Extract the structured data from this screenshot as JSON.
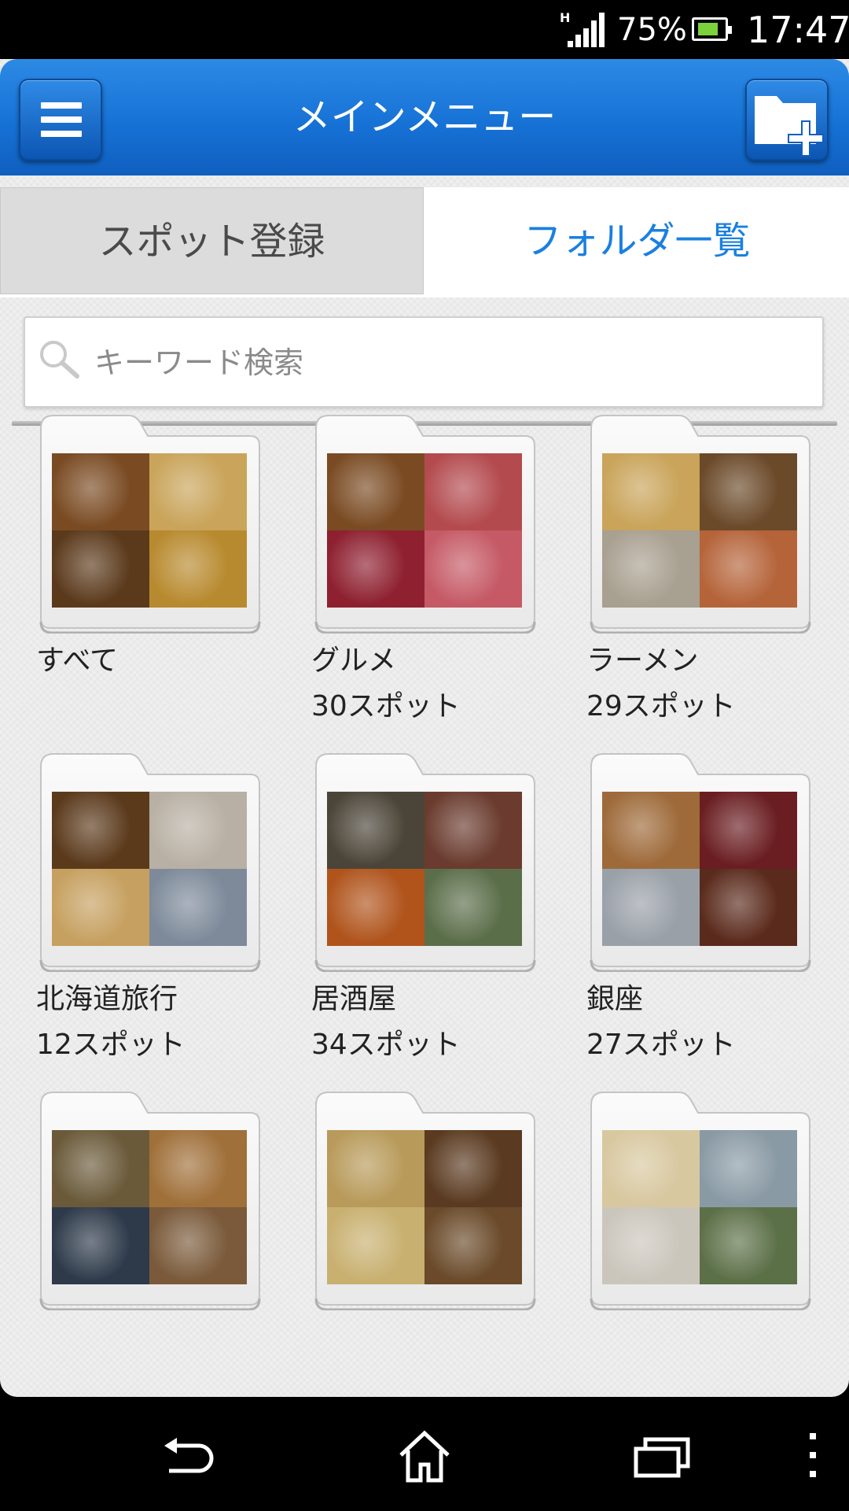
{
  "status_bar": {
    "network_type": "H",
    "battery_percent": "75%",
    "time": "17:47"
  },
  "header": {
    "title": "メインメニュー",
    "menu_icon": "hamburger-menu-icon",
    "add_icon": "add-folder-icon"
  },
  "tabs": [
    {
      "label": "スポット登録",
      "selected": false
    },
    {
      "label": "フォルダ一覧",
      "selected": true
    }
  ],
  "search": {
    "placeholder": "キーワード検索",
    "value": ""
  },
  "folders": [
    {
      "name": "すべて",
      "count": "",
      "thumbs": [
        "#7a4b23",
        "#c9a45a",
        "#5b3a1c",
        "#b88a2f"
      ]
    },
    {
      "name": "グルメ",
      "count": "30スポット",
      "thumbs": [
        "#7a4b23",
        "#b34a4e",
        "#8e2030",
        "#c55a66"
      ]
    },
    {
      "name": "ラーメン",
      "count": "29スポット",
      "thumbs": [
        "#c9a45a",
        "#6b4a2a",
        "#a8a090",
        "#b5643a"
      ]
    },
    {
      "name": "北海道旅行",
      "count": "12スポット",
      "thumbs": [
        "#5b3a1c",
        "#b8b0a4",
        "#c6a060",
        "#7e8a9a"
      ]
    },
    {
      "name": "居酒屋",
      "count": "34スポット",
      "thumbs": [
        "#4b4438",
        "#6a3b2e",
        "#b0541c",
        "#5b6e4a"
      ]
    },
    {
      "name": "銀座",
      "count": "27スポット",
      "thumbs": [
        "#9e6a3a",
        "#6a1e22",
        "#9aa0a8",
        "#5a2a1c"
      ]
    },
    {
      "name": "",
      "count": "",
      "thumbs": [
        "#6a5a3a",
        "#a0703a",
        "#2e3a4a",
        "#7a5a3a"
      ]
    },
    {
      "name": "",
      "count": "",
      "thumbs": [
        "#b89a5a",
        "#5a3a20",
        "#c8b070",
        "#6a4a2a"
      ]
    },
    {
      "name": "",
      "count": "",
      "thumbs": [
        "#d8c8a0",
        "#8a9aa4",
        "#cbc6bc",
        "#5c7048"
      ]
    }
  ],
  "nav_bar": {
    "back_icon": "back-icon",
    "home_icon": "home-icon",
    "recents_icon": "recent-apps-icon",
    "overflow_icon": "overflow-menu-icon"
  }
}
